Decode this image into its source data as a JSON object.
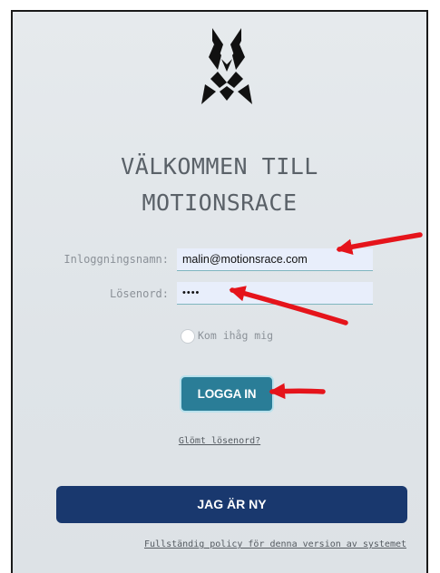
{
  "welcome": {
    "line1": "VÄLKOMMEN TILL",
    "line2": "MOTIONSRACE"
  },
  "login_form": {
    "username_label": "Inloggningsnamn:",
    "username_value": "malin@motionsrace.com",
    "password_label": "Lösenord:",
    "password_value": "••••",
    "remember_label": "Kom ihåg mig",
    "submit_label": "LOGGA IN",
    "forgot_label": "Glömt lösenord?"
  },
  "register": {
    "button_label": "JAG ÄR NY"
  },
  "footer": {
    "policy_label": "Fullständig policy för denna version av systemet"
  },
  "colors": {
    "login_button": "#2a7d97",
    "new_button": "#19386e",
    "annotation_arrow": "#e5141b"
  },
  "icons": {
    "logo": "fox-logo-icon",
    "annotation": "red-arrow-annotation"
  }
}
